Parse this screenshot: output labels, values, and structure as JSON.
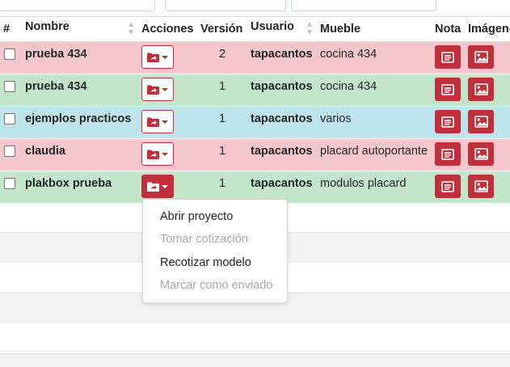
{
  "table": {
    "headers": [
      "#",
      "Nombre",
      "Acciones",
      "Versión",
      "Usuario",
      "Mueble",
      "Nota",
      "Imágenes"
    ],
    "rows": [
      {
        "nombre": "prueba 434",
        "version": "2",
        "usuario": "tapacantos",
        "mueble": "cocina 434"
      },
      {
        "nombre": "prueba 434",
        "version": "1",
        "usuario": "tapacantos",
        "mueble": "cocina 434"
      },
      {
        "nombre": "ejemplos practicos",
        "version": "1",
        "usuario": "tapacantos",
        "mueble": "varios"
      },
      {
        "nombre": "claudia",
        "version": "1",
        "usuario": "tapacantos",
        "mueble": "placard autoportante"
      },
      {
        "nombre": "plakbox prueba",
        "version": "1",
        "usuario": "tapacantos",
        "mueble": "modulos placard"
      }
    ]
  },
  "row_colors": {
    "pink": "#f5c6cb",
    "green": "#c3e6cb",
    "blue": "#bee5eb"
  },
  "accent_color": "#c0303b",
  "icons": {
    "actions": "folder-share-icon",
    "note": "note-icon",
    "image": "image-icon",
    "sort": "sort-icon"
  },
  "dropdown": {
    "items": [
      {
        "label": "Abrir proyecto",
        "enabled": true
      },
      {
        "label": "Tomar cotización",
        "enabled": false
      },
      {
        "label": "Recotizar modelo",
        "enabled": true
      },
      {
        "label": "Marcar como enviado",
        "enabled": false
      }
    ]
  }
}
